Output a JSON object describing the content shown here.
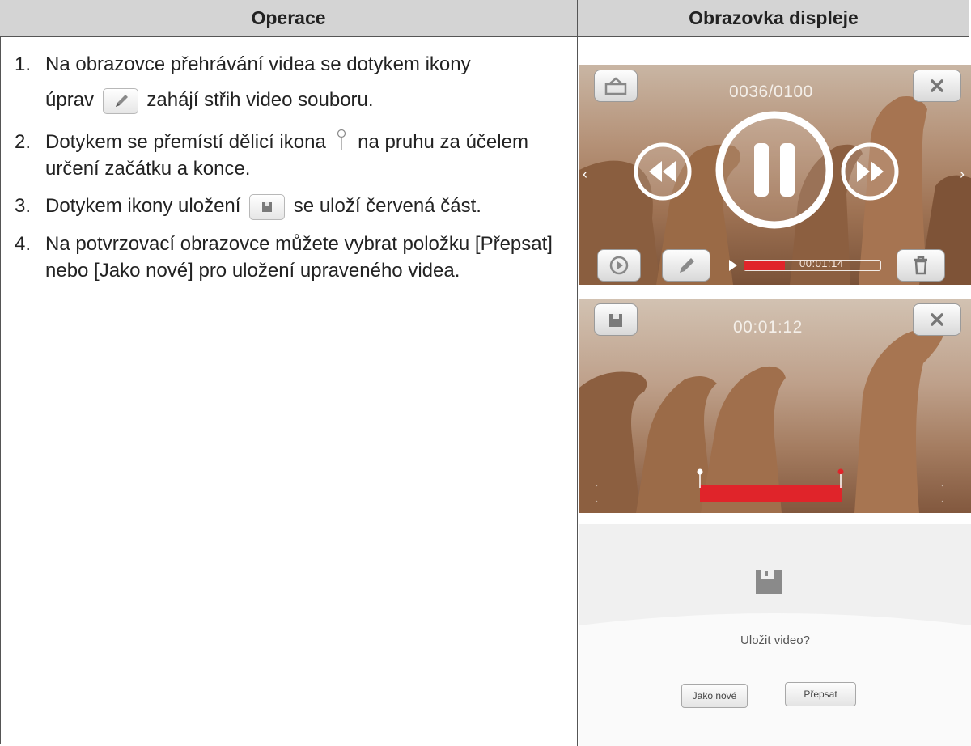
{
  "table": {
    "header_left": "Operace",
    "header_right": "Obrazovka displeje"
  },
  "steps": [
    {
      "num": "1.",
      "text_a": "Na obrazovce přehrávání videa se dotykem ikony",
      "text_b": "úprav",
      "icon": "edit-pencil-icon",
      "text_c": "zahájí střih video souboru."
    },
    {
      "num": "2.",
      "text_a": "Dotykem se přemístí dělicí ikona",
      "icon": "split-pin-icon",
      "text_b": "na pruhu za účelem určení začátku a konce."
    },
    {
      "num": "3.",
      "text_a": "Dotykem ikony uložení",
      "icon": "save-icon",
      "text_b": "se uloží červená část."
    },
    {
      "num": "4.",
      "text_a": "Na potvrzovací obrazovce můžete vybrat položku [Přepsat] nebo [Jako nové] pro uložení upraveného videa."
    }
  ],
  "screen1": {
    "counter": "0036/0100",
    "time": "00:01:14",
    "icons": [
      "home-menu-icon",
      "close-icon",
      "rewind-icon",
      "pause-icon",
      "fast-forward-icon",
      "rotate-icon",
      "edit-pencil-icon",
      "play-icon",
      "delete-trash-icon"
    ],
    "progress_fraction": 0.3
  },
  "screen2": {
    "time": "00:01:12",
    "icons": [
      "save-icon",
      "close-icon"
    ],
    "selection_start_fraction": 0.3,
    "selection_end_fraction": 0.71
  },
  "screen3": {
    "question": "Uložit video?",
    "btn_new": "Jako nové",
    "btn_overwrite": "Přepsat",
    "icons": [
      "save-icon"
    ]
  }
}
